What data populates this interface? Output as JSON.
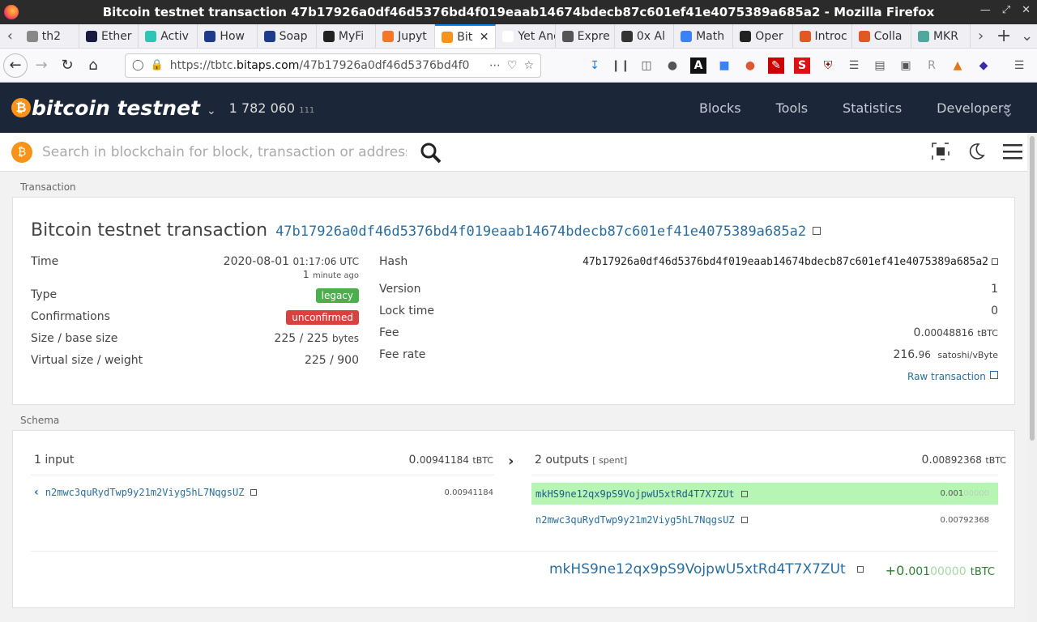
{
  "window": {
    "title": "Bitcoin testnet transaction 47b17926a0df46d5376bd4f019eaab14674bdecb87c601ef41e4075389a685a2 - Mozilla Firefox"
  },
  "tabs": [
    {
      "label": "th2",
      "color": "#888"
    },
    {
      "label": "Ether",
      "color": "#1a1a40"
    },
    {
      "label": "Activ",
      "color": "#2ec4b6"
    },
    {
      "label": "How",
      "color": "#1e3a8a"
    },
    {
      "label": "Soap",
      "color": "#1e3a8a"
    },
    {
      "label": "MyFi",
      "color": "#222"
    },
    {
      "label": "Jupyt",
      "color": "#f37726"
    },
    {
      "label": "Bit",
      "color": "#f7931a",
      "active": true
    },
    {
      "label": "Yet Anot",
      "color": "#fff"
    },
    {
      "label": "Expre",
      "color": "#555"
    },
    {
      "label": "0x Al",
      "color": "#333"
    },
    {
      "label": "Math",
      "color": "#3b82f6"
    },
    {
      "label": "Oper",
      "color": "#222"
    },
    {
      "label": "Introc",
      "color": "#e25822"
    },
    {
      "label": "Colla",
      "color": "#e25822"
    },
    {
      "label": "MKR",
      "color": "#4fa89b"
    }
  ],
  "address_bar": {
    "prefix": "https://tbtc.",
    "domain": "bitaps.com",
    "path": "/47b17926a0df46d5376bd4f0"
  },
  "site": {
    "logo_text": "bitcoin testnet",
    "block_height": "1 782 060",
    "block_height_sub": "111",
    "menu": [
      "Blocks",
      "Tools",
      "Statistics",
      "Developers"
    ],
    "search_placeholder": "Search in blockchain for block, transaction or address ..."
  },
  "transaction": {
    "section_label": "Transaction",
    "title": "Bitcoin testnet transaction",
    "txid": "47b17926a0df46d5376bd4f019eaab14674bdecb87c601ef41e4075389a685a2",
    "left": {
      "time_label": "Time",
      "time_date": "2020-08-01",
      "time_clock": "01:17:06 UTC",
      "time_ago_num": "1",
      "time_ago": "minute ago",
      "type_label": "Type",
      "type_value": "legacy",
      "confirmations_label": "Confirmations",
      "confirmations_value": "unconfirmed",
      "size_label": "Size / base size",
      "size_value": "225 / 225",
      "size_unit": "bytes",
      "vsize_label": "Virtual size / weight",
      "vsize_value": "225 / 900"
    },
    "right": {
      "hash_label": "Hash",
      "hash_value": "47b17926a0df46d5376bd4f019eaab14674bdecb87c601ef41e4075389a685a2",
      "version_label": "Version",
      "version_value": "1",
      "locktime_label": "Lock time",
      "locktime_value": "0",
      "fee_label": "Fee",
      "fee_big": "0.",
      "fee_small": "00048816",
      "fee_unit": "tBTC",
      "feerate_label": "Fee rate",
      "feerate_big": "216.",
      "feerate_small": "96",
      "feerate_unit": "satoshi/vByte",
      "raw_link": "Raw transaction"
    }
  },
  "schema": {
    "section_label": "Schema",
    "inputs_label": "1 input",
    "inputs_total_big": "0.",
    "inputs_total_small": "00941184",
    "inputs_unit": "tBTC",
    "input_address": "n2mwc3quRydTwp9y21m2Viyg5hL7NqgsUZ",
    "input_amount": "0.00941184",
    "outputs_label": "2 outputs",
    "outputs_spent": "[ spent]",
    "outputs_total_big": "0.",
    "outputs_total_small": "00892368",
    "outputs_unit": "tBTC",
    "outputs": [
      {
        "address": "mkHS9ne12qx9pS9VojpwU5xtRd4T7X7ZUt",
        "amount": "0.001",
        "amount_zeros": "00000"
      },
      {
        "address": "n2mwc3quRydTwp9y21m2Viyg5hL7NqgsUZ",
        "amount": "0.00792368",
        "amount_zeros": ""
      }
    ],
    "highlight_address": "mkHS9ne12qx9pS9VojpwU5xtRd4T7X7ZUt",
    "highlight_amount_prefix": "+0.",
    "highlight_amount_mid": "001",
    "highlight_amount_zeros": "00000",
    "highlight_unit": "tBTC"
  }
}
